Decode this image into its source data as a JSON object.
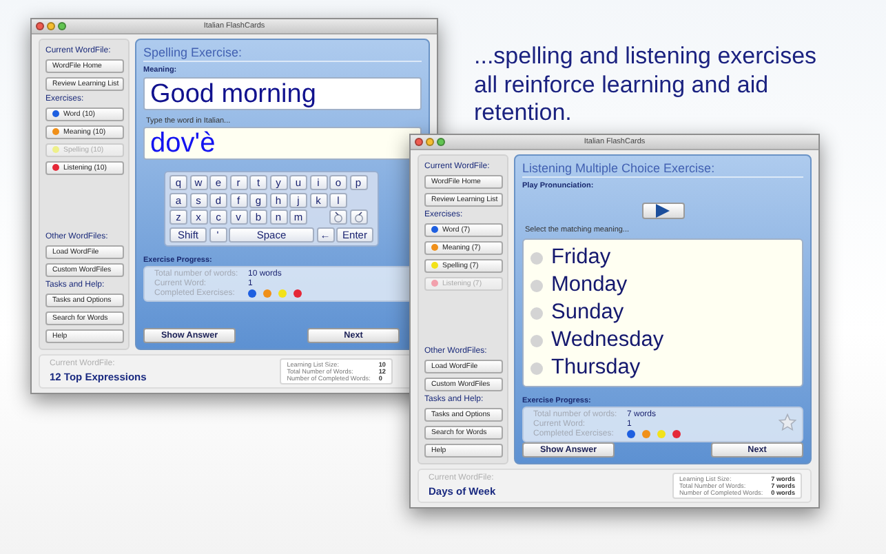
{
  "tagline": "...spelling and listening exercises all reinforce learning and aid retention.",
  "windows": [
    {
      "title": "Italian FlashCards",
      "kind": "spelling",
      "sidebar": {
        "top": [
          {
            "heading": "Current WordFile:",
            "items": [
              {
                "label": "WordFile Home"
              },
              {
                "label": "Review Learning List"
              }
            ]
          },
          {
            "heading": "Exercises:",
            "items": [
              {
                "label": "Word (10)",
                "color": "#1e5fe0",
                "disabled": false
              },
              {
                "label": "Meaning (10)",
                "color": "#f0901a",
                "disabled": false
              },
              {
                "label": "Spelling (10)",
                "color": "#eef08a",
                "disabled": true
              },
              {
                "label": "Listening (10)",
                "color": "#e52838",
                "disabled": false
              }
            ]
          }
        ],
        "bottom": [
          {
            "heading": "Other WordFiles:",
            "items": [
              {
                "label": "Load WordFile"
              },
              {
                "label": "Custom WordFiles"
              }
            ]
          },
          {
            "heading": "Tasks and Help:",
            "items": [
              {
                "label": "Tasks and Options"
              },
              {
                "label": "Search for Words"
              },
              {
                "label": "Help"
              }
            ]
          }
        ]
      },
      "exercise": {
        "title": "Spelling Exercise:",
        "meaning_label": "Meaning:",
        "meaning": "Good morning",
        "input_prompt": "Type the word in Italian...",
        "input_value": "dov'è",
        "keyboard": [
          [
            {
              "label": "q",
              "kind": "letter"
            },
            {
              "label": "w",
              "kind": "letter"
            },
            {
              "label": "e",
              "kind": "letter"
            },
            {
              "label": "r",
              "kind": "letter"
            },
            {
              "label": "t",
              "kind": "letter"
            },
            {
              "label": "y",
              "kind": "letter"
            },
            {
              "label": "u",
              "kind": "letter"
            },
            {
              "label": "i",
              "kind": "letter"
            },
            {
              "label": "o",
              "kind": "letter"
            },
            {
              "label": "p",
              "kind": "letter"
            }
          ],
          [
            {
              "label": "a",
              "kind": "letter"
            },
            {
              "label": "s",
              "kind": "letter"
            },
            {
              "label": "d",
              "kind": "letter"
            },
            {
              "label": "f",
              "kind": "letter"
            },
            {
              "label": "g",
              "kind": "letter"
            },
            {
              "label": "h",
              "kind": "letter"
            },
            {
              "label": "j",
              "kind": "letter"
            },
            {
              "label": "k",
              "kind": "letter"
            },
            {
              "label": "l",
              "kind": "letter"
            }
          ],
          [
            {
              "label": "z",
              "kind": "letter"
            },
            {
              "label": "x",
              "kind": "letter"
            },
            {
              "label": "c",
              "kind": "letter"
            },
            {
              "label": "v",
              "kind": "letter"
            },
            {
              "label": "b",
              "kind": "letter"
            },
            {
              "label": "n",
              "kind": "letter"
            },
            {
              "label": "m",
              "kind": "letter"
            },
            {
              "kind": "gap"
            },
            {
              "kind": "grave"
            },
            {
              "kind": "acute"
            }
          ],
          [
            {
              "label": "Shift",
              "kind": "wide"
            },
            {
              "label": "'",
              "kind": "letter"
            },
            {
              "label": "Space",
              "kind": "space"
            },
            {
              "label": "←",
              "kind": "letter"
            },
            {
              "label": "Enter",
              "kind": "wide"
            }
          ]
        ]
      },
      "progress": {
        "label": "Exercise Progress:",
        "rows": [
          {
            "label": "Total number of words:",
            "value": "10 words"
          },
          {
            "label": "Current Word:",
            "value": "1"
          },
          {
            "label": "Completed Exercises:",
            "dots": [
              {
                "color": "#1e5fe0"
              },
              {
                "color": "#f0901a"
              },
              {
                "color": "#f2e21a"
              },
              {
                "color": "#e52838"
              }
            ]
          }
        ]
      },
      "buttons": [
        "Show Answer",
        "Next"
      ],
      "status": {
        "label": "Current WordFile:",
        "name": "12 Top Expressions",
        "stats": [
          {
            "label": "Learning List Size:",
            "value": "10"
          },
          {
            "label": "Total Number of Words:",
            "value": "12"
          },
          {
            "label": "Number of Completed Words:",
            "value": "0"
          }
        ]
      }
    },
    {
      "title": "Italian FlashCards",
      "kind": "listening",
      "sidebar": {
        "top": [
          {
            "heading": "Current WordFile:",
            "items": [
              {
                "label": "WordFile Home"
              },
              {
                "label": "Review Learning List"
              }
            ]
          },
          {
            "heading": "Exercises:",
            "items": [
              {
                "label": "Word (7)",
                "color": "#1e5fe0",
                "disabled": false
              },
              {
                "label": "Meaning (7)",
                "color": "#f0901a",
                "disabled": false
              },
              {
                "label": "Spelling (7)",
                "color": "#f2e21a",
                "disabled": false
              },
              {
                "label": "Listening (7)",
                "color": "#f2a0ac",
                "disabled": true
              }
            ]
          }
        ],
        "bottom": [
          {
            "heading": "Other WordFiles:",
            "items": [
              {
                "label": "Load WordFile"
              },
              {
                "label": "Custom WordFiles"
              }
            ]
          },
          {
            "heading": "Tasks and Help:",
            "items": [
              {
                "label": "Tasks and Options"
              },
              {
                "label": "Search for Words"
              },
              {
                "label": "Help"
              }
            ]
          }
        ]
      },
      "exercise": {
        "title": "Listening Multiple Choice Exercise:",
        "play_label": "Play Pronunciation:",
        "choices_prompt": "Select the matching meaning...",
        "choices": [
          {
            "label": "Friday",
            "selected": false
          },
          {
            "label": "Monday",
            "selected": false
          },
          {
            "label": "Sunday",
            "selected": false
          },
          {
            "label": "Wednesday",
            "selected": false
          },
          {
            "label": "Thursday",
            "selected": false
          }
        ]
      },
      "progress": {
        "label": "Exercise Progress:",
        "star": {
          "filled": false
        },
        "rows": [
          {
            "label": "Total number of words:",
            "value": "7 words"
          },
          {
            "label": "Current Word:",
            "value": "1"
          },
          {
            "label": "Completed Exercises:",
            "dots": [
              {
                "color": "#1e5fe0"
              },
              {
                "color": "#f0901a"
              },
              {
                "color": "#f2e21a"
              },
              {
                "color": "#e52838"
              }
            ]
          }
        ]
      },
      "buttons": [
        "Show Answer",
        "Next"
      ],
      "status": {
        "label": "Current WordFile:",
        "name": "Days of Week",
        "stats": [
          {
            "label": "Learning List Size:",
            "value": "7 words"
          },
          {
            "label": "Total Number of Words:",
            "value": "7 words"
          },
          {
            "label": "Number of Completed Words:",
            "value": "0 words"
          }
        ]
      }
    }
  ]
}
